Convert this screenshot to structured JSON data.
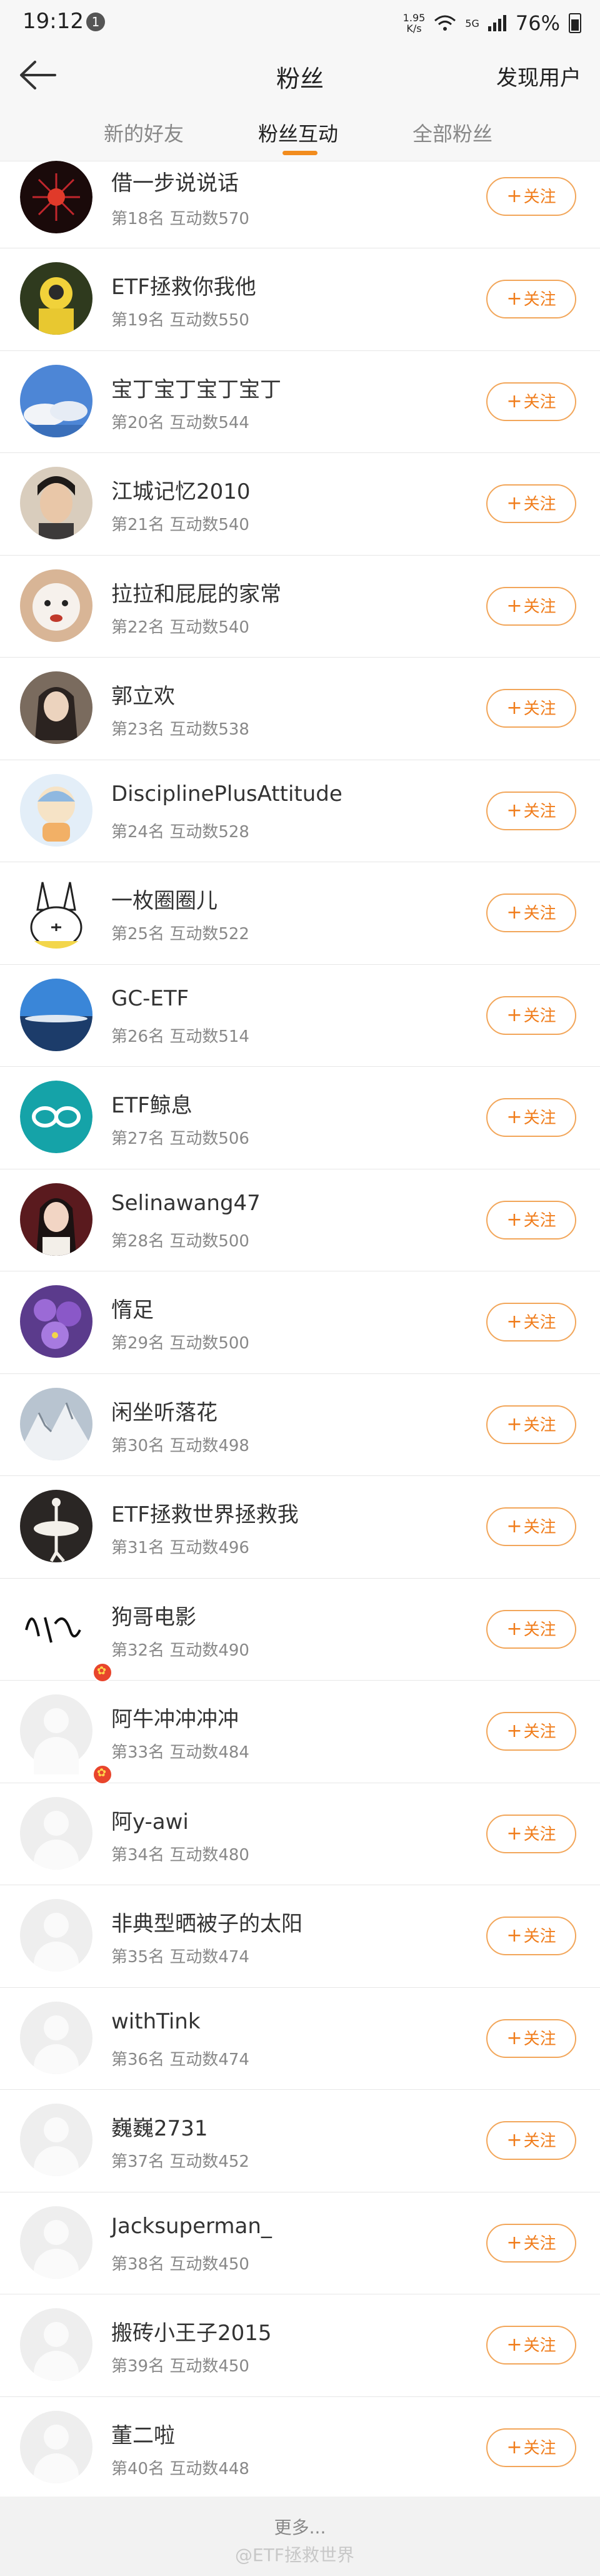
{
  "status_bar": {
    "time": "19:12",
    "notif_count": "1",
    "speed_value": "1.95",
    "speed_unit": "K/s",
    "network": "5G",
    "battery": "76%"
  },
  "header": {
    "title": "粉丝",
    "discover": "发现用户"
  },
  "tabs": [
    {
      "label": "新的好友",
      "active": false
    },
    {
      "label": "粉丝互动",
      "active": true
    },
    {
      "label": "全部粉丝",
      "active": false
    }
  ],
  "follow_label": "关注",
  "fans": [
    {
      "name": "借一步说说话",
      "meta": "第18名 互动数570"
    },
    {
      "name": "ETF拯救你我他",
      "meta": "第19名 互动数550"
    },
    {
      "name": "宝丁宝丁宝丁宝丁",
      "meta": "第20名 互动数544"
    },
    {
      "name": "江城记忆2010",
      "meta": "第21名 互动数540"
    },
    {
      "name": "拉拉和屁屁的家常",
      "meta": "第22名 互动数540"
    },
    {
      "name": "郭立欢",
      "meta": "第23名 互动数538"
    },
    {
      "name": "DisciplinePlusAttitude",
      "meta": "第24名 互动数528"
    },
    {
      "name": "一枚圈圈儿",
      "meta": "第25名 互动数522"
    },
    {
      "name": "GC-ETF",
      "meta": "第26名 互动数514"
    },
    {
      "name": "ETF鲸息",
      "meta": "第27名 互动数506"
    },
    {
      "name": "Selinawang47",
      "meta": "第28名 互动数500"
    },
    {
      "name": "惰足",
      "meta": "第29名 互动数500"
    },
    {
      "name": "闲坐听落花",
      "meta": "第30名 互动数498"
    },
    {
      "name": "ETF拯救世界拯救我",
      "meta": "第31名 互动数496"
    },
    {
      "name": "狗哥电影",
      "meta": "第32名 互动数490"
    },
    {
      "name": "阿牛冲冲冲冲",
      "meta": "第33名 互动数484"
    },
    {
      "name": "阿y-awi",
      "meta": "第34名 互动数480"
    },
    {
      "name": "非典型晒被子的太阳",
      "meta": "第35名 互动数474"
    },
    {
      "name": "withTink",
      "meta": "第36名 互动数474"
    },
    {
      "name": "巍巍2731",
      "meta": "第37名 互动数452"
    },
    {
      "name": "Jacksuperman_",
      "meta": "第38名 互动数450"
    },
    {
      "name": "搬砖小王子2015",
      "meta": "第39名 互动数450"
    },
    {
      "name": "董二啦",
      "meta": "第40名 互动数448"
    }
  ],
  "footer": {
    "more": "更多...",
    "watermark": "@ETF拯救世界"
  },
  "colors": {
    "accent": "#f07d1c",
    "follow_border": "#f2a65a"
  }
}
